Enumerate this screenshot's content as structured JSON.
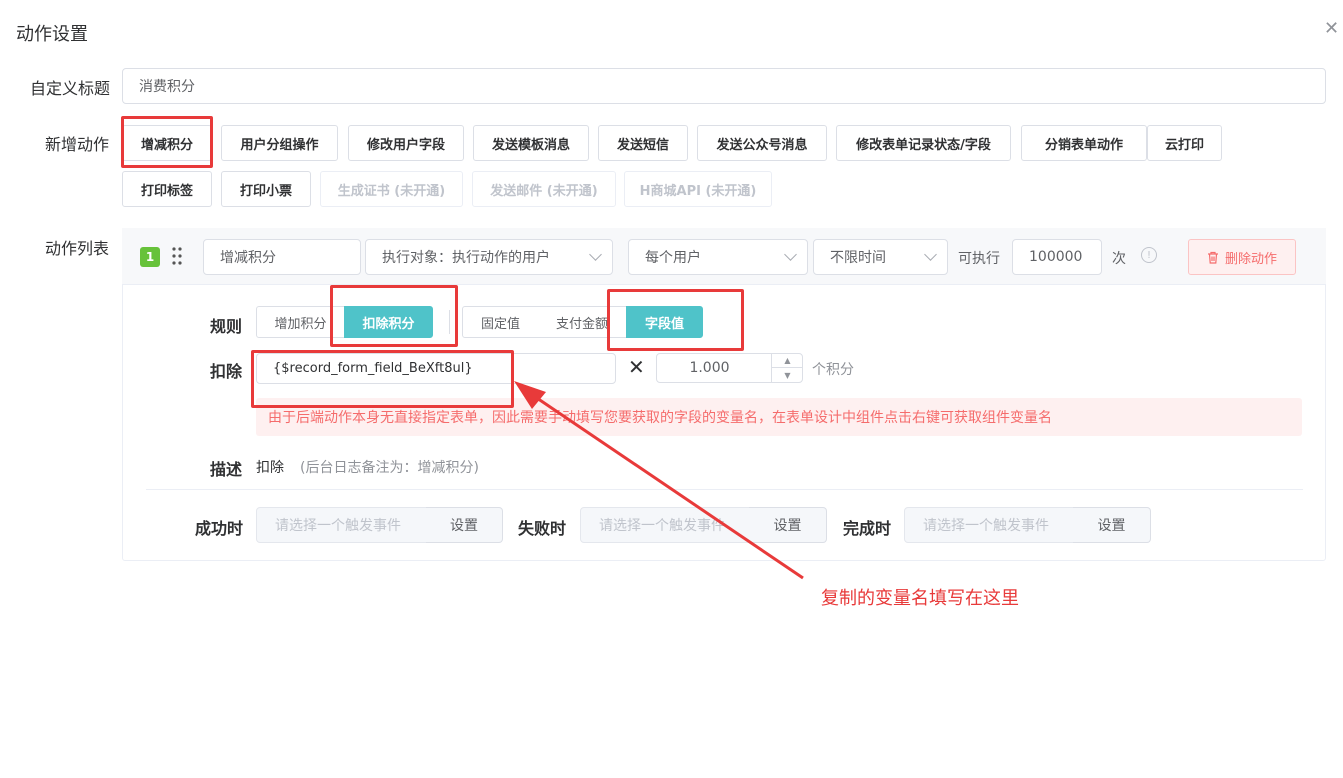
{
  "dialog": {
    "title": "动作设置"
  },
  "custom_title": {
    "label": "自定义标题",
    "value": "消费积分"
  },
  "new_action": {
    "label": "新增动作",
    "buttons": [
      "增减积分",
      "用户分组操作",
      "修改用户字段",
      "发送模板消息",
      "发送短信",
      "发送公众号消息",
      "修改表单记录状态/字段",
      "分销表单动作",
      "云打印",
      "打印标签",
      "打印小票"
    ],
    "disabled_buttons": [
      "生成证书 (未开通)",
      "发送邮件 (未开通)",
      "H商城API (未开通)"
    ]
  },
  "action_list": {
    "label": "动作列表",
    "index": "1",
    "name": "增减积分",
    "target": "执行对象：执行动作的用户",
    "per": "每个用户",
    "time": "不限时间",
    "can_exec_label": "可执行",
    "times_value": "100000",
    "times_unit": "次",
    "delete_label": "删除动作"
  },
  "rule": {
    "label": "规则",
    "mode_add": "增加积分",
    "mode_deduct": "扣除积分",
    "src_fixed": "固定值",
    "src_pay": "支付金额",
    "src_field": "字段值"
  },
  "deduct": {
    "label": "扣除",
    "field_value": "{$record_form_field_BeXft8ul}",
    "multiplier": "1.000",
    "unit": "个积分",
    "notice": "由于后端动作本身无直接指定表单，因此需要手动填写您要获取的字段的变量名，在表单设计中组件点击右键可获取组件变量名"
  },
  "desc": {
    "label": "描述",
    "value": "扣除",
    "note": "(后台日志备注为：增减积分)"
  },
  "triggers": {
    "success_label": "成功时",
    "fail_label": "失败时",
    "done_label": "完成时",
    "placeholder": "请选择一个触发事件",
    "set_label": "设置"
  },
  "annotation": {
    "text": "复制的变量名填写在这里",
    "color": "#e83a3a"
  },
  "colors": {
    "accent": "#4fc3c9",
    "badge": "#67c23a",
    "annotation": "#e83a3a"
  }
}
